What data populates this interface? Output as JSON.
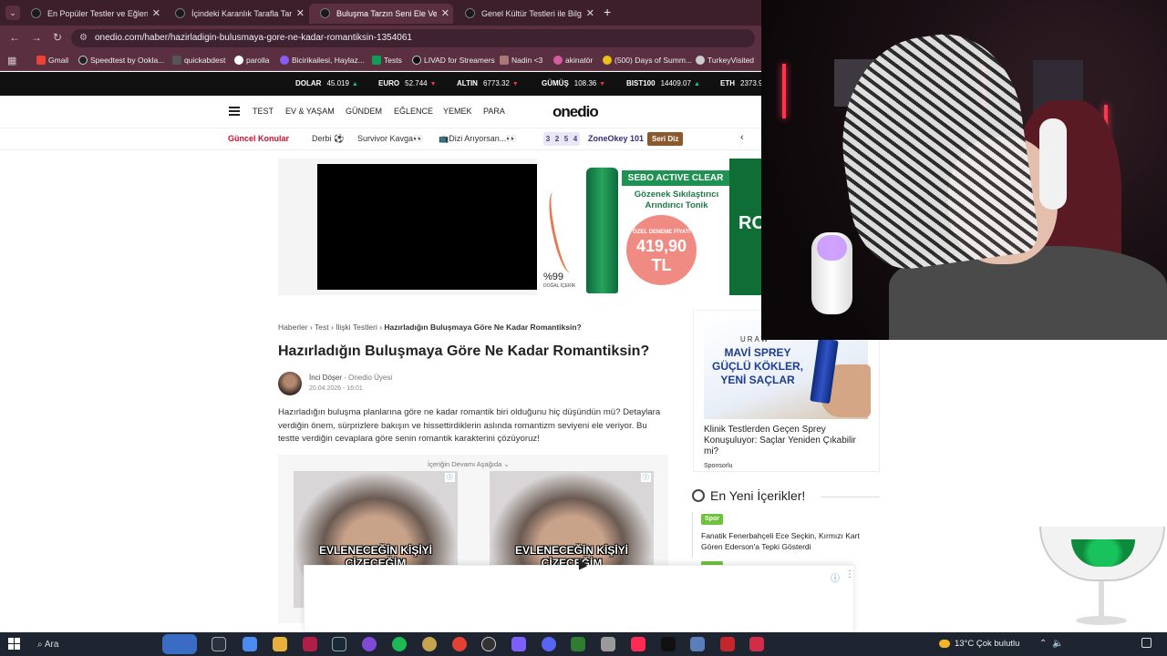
{
  "browser": {
    "tabs": [
      {
        "label": "En Popüler Testler ve Eğlenceli"
      },
      {
        "label": "İçindeki Karanlık Tarafla Tanışm"
      },
      {
        "label": "Buluşma Tarzın Seni Ele Veriyor"
      },
      {
        "label": "Genel Kültür Testleri ile Bilgini T"
      }
    ],
    "url": "onedio.com/haber/hazirladigin-bulusmaya-gore-ne-kadar-romantiksin-1354061",
    "bookmarks": [
      {
        "label": "Gmail"
      },
      {
        "label": "Speedtest by Ookla..."
      },
      {
        "label": "quickabdest"
      },
      {
        "label": "parolla"
      },
      {
        "label": "Bicirikailesi, Haylaz..."
      },
      {
        "label": "Tests"
      },
      {
        "label": "LIVAD for Streamers"
      },
      {
        "label": "Nadin <3"
      },
      {
        "label": "akinatör"
      },
      {
        "label": "(500) Days of Summ..."
      },
      {
        "label": "TurkeyVisited"
      }
    ]
  },
  "ticker": [
    {
      "name": "DOLAR",
      "value": "45.019",
      "dir": "up"
    },
    {
      "name": "EURO",
      "value": "52.744",
      "dir": "down"
    },
    {
      "name": "ALTIN",
      "value": "6773.32",
      "dir": "down"
    },
    {
      "name": "GÜMÜŞ",
      "value": "108.36",
      "dir": "down"
    },
    {
      "name": "BIST100",
      "value": "14409.07",
      "dir": "up"
    },
    {
      "name": "ETH",
      "value": "2373.9"
    }
  ],
  "site": {
    "logo": "onedio",
    "nav": [
      "TEST",
      "EV & YAŞAM",
      "GÜNDEM",
      "EĞLENCE",
      "YEMEK",
      "PARA"
    ],
    "trending_label": "Güncel Konular",
    "trending": [
      "Derbi ⚽",
      "Survivor Kavga👀",
      "📺Dizi Arıyorsan...👀"
    ],
    "numbers": [
      "3",
      "2",
      "5",
      "4"
    ],
    "zone": "ZoneOkey 101",
    "seri": "Seri Diz"
  },
  "ad": {
    "banner": "SEBO ACTIVE CLEAR",
    "sub": "Gözenek Sıkılaştırıcı Arındırıcı Tonik",
    "price_label": "ÖZEL DENEME FİYATI",
    "price": "419,90 TL",
    "pct": "%99",
    "pct_sub": "DOĞAL İÇERİK",
    "edge": "RO"
  },
  "article": {
    "breadcrumb": [
      "Haberler",
      "Test",
      "İlişki Testleri",
      "Hazırladığın Buluşmaya Göre Ne Kadar Romantiksin?"
    ],
    "title": "Hazırladığın Buluşmaya Göre Ne Kadar Romantiksin?",
    "author": "İnci Döşer",
    "author_role": " - Onedio Üyesi",
    "date": "20.04.2026 - 16:01",
    "intro": "Hazırladığın buluşma planlarına göre ne kadar romantik biri olduğunu hiç düşündün mü? Detaylara verdiğin önem, sürprizlere bakışın ve hissettirdiklerin aslında romantizm seviyeni ele veriyor. Bu testte verdiğin cevaplara göre senin romantik karakterini çözüyoruz!",
    "continue_label": "İçeriğin Devamı Aşağıda ⌄",
    "promo_caption_1": "EVLENECEĞİN KİŞİYİ ÇİZECEĞİM",
    "promo_caption_2": "EVLENECEĞİN KİŞİYİ ÇİZECEĞİM"
  },
  "sidebar": {
    "ad_brand": "URAW",
    "ad_headline": "MAVİ SPREY GÜÇLÜ KÖKLER, YENİ SAÇLAR",
    "ad_text": "Klinik Testlerden Geçen Sprey Konuşuluyor: Saçlar Yeniden Çıkabilir mi?",
    "sponsor": "Sponsorlu",
    "new_heading": "En Yeni İçerikler!",
    "news": [
      {
        "tag": "Spor",
        "text": "Fanatik Fenerbahçeli Ece Seçkin, Kırmızı Kart Gören Ederson'a Tepki Gösterdi"
      }
    ]
  },
  "taskbar": {
    "search": "Ara",
    "weather": "13°C  Çok bulutlu"
  }
}
